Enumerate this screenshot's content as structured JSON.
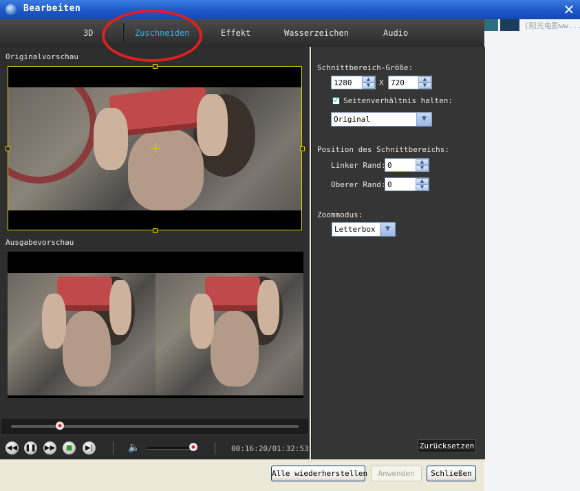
{
  "window": {
    "title": "Bearbeiten",
    "close_symbol": "✕",
    "behind_text": "[阳光电影ww..."
  },
  "tabs": [
    {
      "label": "3D",
      "active": false
    },
    {
      "label": "Zuschneiden",
      "active": true
    },
    {
      "label": "Effekt",
      "active": false
    },
    {
      "label": "Wasserzeichen",
      "active": false
    },
    {
      "label": "Audio",
      "active": false
    }
  ],
  "preview": {
    "original_label": "Originalvorschau",
    "output_label": "Ausgabevorschau"
  },
  "player": {
    "seek_fraction": 0.17,
    "volume_fraction": 0.93,
    "timecode": "00:16:20/01:32:53",
    "controls": [
      "rewind-icon",
      "pause-icon",
      "fast-forward-icon",
      "stop-icon",
      "next-icon"
    ]
  },
  "crop": {
    "size_label": "Schnittbereich-Größe:",
    "width": "1280",
    "x_sep": "X",
    "height": "720",
    "keep_ratio_label": "Seitenverhältnis halten:",
    "keep_ratio_checked": true,
    "ratio_value": "Original",
    "position_label": "Position des Schnittbereichs:",
    "left_label": "Linker Rand:",
    "left_value": "0",
    "top_label": "Oberer Rand:",
    "top_value": "0",
    "zoom_label": "Zoommodus:",
    "zoom_value": "Letterbox",
    "reset_label": "Zurücksetzen"
  },
  "footer": {
    "restore_all": "Alle wiederherstellen",
    "apply": "Anwenden",
    "close": "Schließen"
  },
  "colors": {
    "accent_tab": "#37b7ee",
    "crop_frame": "#e8d400",
    "annotation_circle": "#e02020"
  }
}
